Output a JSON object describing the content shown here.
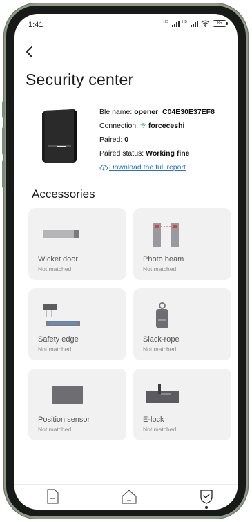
{
  "status_bar": {
    "time": "1:41",
    "signal_label_1": "HD",
    "signal_label_2": "HD",
    "battery": "85"
  },
  "page": {
    "title": "Security center"
  },
  "device_info": {
    "ble_name_label": "Ble name: ",
    "ble_name_value": "opener_C04E30E37EF8",
    "connection_label": "Connection: ",
    "connection_value": "forceceshi",
    "paired_label": "Paired: ",
    "paired_value": "0",
    "paired_status_label": "Paired status: ",
    "paired_status_value": "Working fine",
    "report_link": "Download the full report"
  },
  "accessories": {
    "title": "Accessories",
    "items": [
      {
        "name": "Wicket door",
        "status": "Not matched"
      },
      {
        "name": "Photo beam",
        "status": "Not matched"
      },
      {
        "name": "Safety edge",
        "status": "Not matched"
      },
      {
        "name": "Slack-rope",
        "status": "Not matched"
      },
      {
        "name": "Position sensor",
        "status": "Not matched"
      },
      {
        "name": "E-lock",
        "status": "Not matched"
      }
    ]
  },
  "bottom_nav": {
    "items": [
      "document-icon",
      "home-icon",
      "shield-check-icon"
    ],
    "active": "shield-check-icon"
  },
  "colors": {
    "link": "#2b6fd6",
    "wifi": "#2eb872",
    "card_bg": "#f1f1f2"
  }
}
